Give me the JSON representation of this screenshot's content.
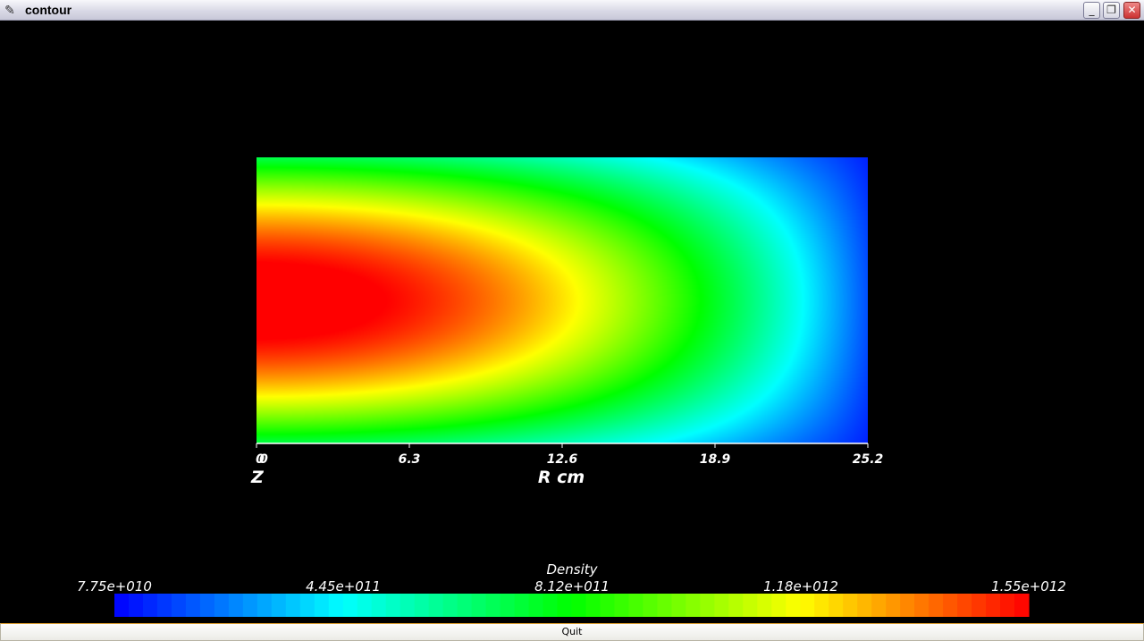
{
  "window": {
    "title": "contour",
    "icon": "feather-icon",
    "controls": {
      "minimize": "_",
      "maximize": "❐",
      "close": "✕"
    }
  },
  "plot": {
    "xticks": [
      "0",
      "6.3",
      "12.6",
      "18.9",
      "25.2"
    ],
    "z_tick": "0",
    "z_label": "Z",
    "x_label": "R cm"
  },
  "colorbar": {
    "title": "Density",
    "ticks": [
      "7.75e+010",
      "4.45e+011",
      "8.12e+011",
      "1.18e+012",
      "1.55e+012"
    ],
    "colors": [
      "#0000ff",
      "#00ffff",
      "#00ff00",
      "#ffff00",
      "#ff0000"
    ]
  },
  "chart_data": {
    "type": "heatmap",
    "title": "",
    "xlabel": "R cm",
    "ylabel": "Z",
    "xlim": [
      0,
      25.2
    ],
    "x_tick_values": [
      0,
      6.3,
      12.6,
      18.9,
      25.2
    ],
    "colorbar_label": "Density",
    "value_range": [
      77500000000.0,
      1550000000000.0
    ],
    "colorbar_tick_values": [
      77500000000.0,
      445000000000.0,
      812000000000.0,
      1180000000000.0,
      1550000000000.0
    ],
    "peak": {
      "r": 0,
      "z_center": true,
      "value": 1550000000000.0
    }
  },
  "footer": {
    "quit_label": "Quit"
  }
}
